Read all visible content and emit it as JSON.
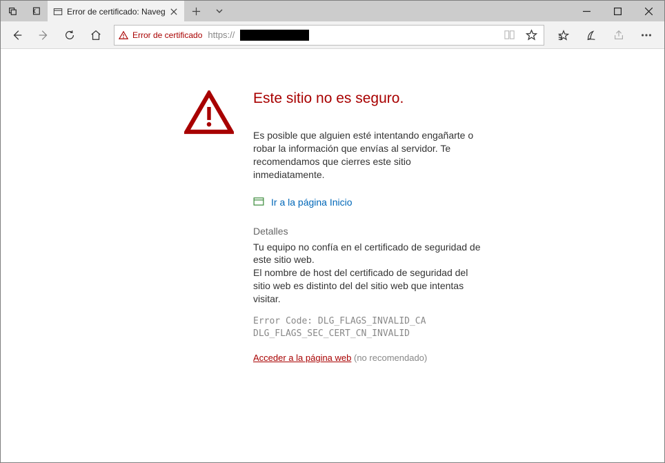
{
  "tab": {
    "title": "Error de certificado: Navegación bloqueada"
  },
  "addressbar": {
    "cert_label": "Error de certificado",
    "protocol": "https://"
  },
  "error": {
    "title": "Este sitio no es seguro.",
    "message": "Es posible que alguien esté intentando engañarte o robar la información que envías al servidor. Te recomendamos que cierres este sitio inmediatamente.",
    "home_link": "Ir a la página Inicio",
    "details_heading": "Detalles",
    "details_text": "Tu equipo no confía en el certificado de seguridad de este sitio web.\nEl nombre de host del certificado de seguridad del sitio web es distinto del del sitio web que intentas visitar.",
    "error_code": "Error Code: DLG_FLAGS_INVALID_CA\nDLG_FLAGS_SEC_CERT_CN_INVALID",
    "proceed_link": "Acceder a la página web",
    "proceed_note": "(no recomendado)"
  }
}
